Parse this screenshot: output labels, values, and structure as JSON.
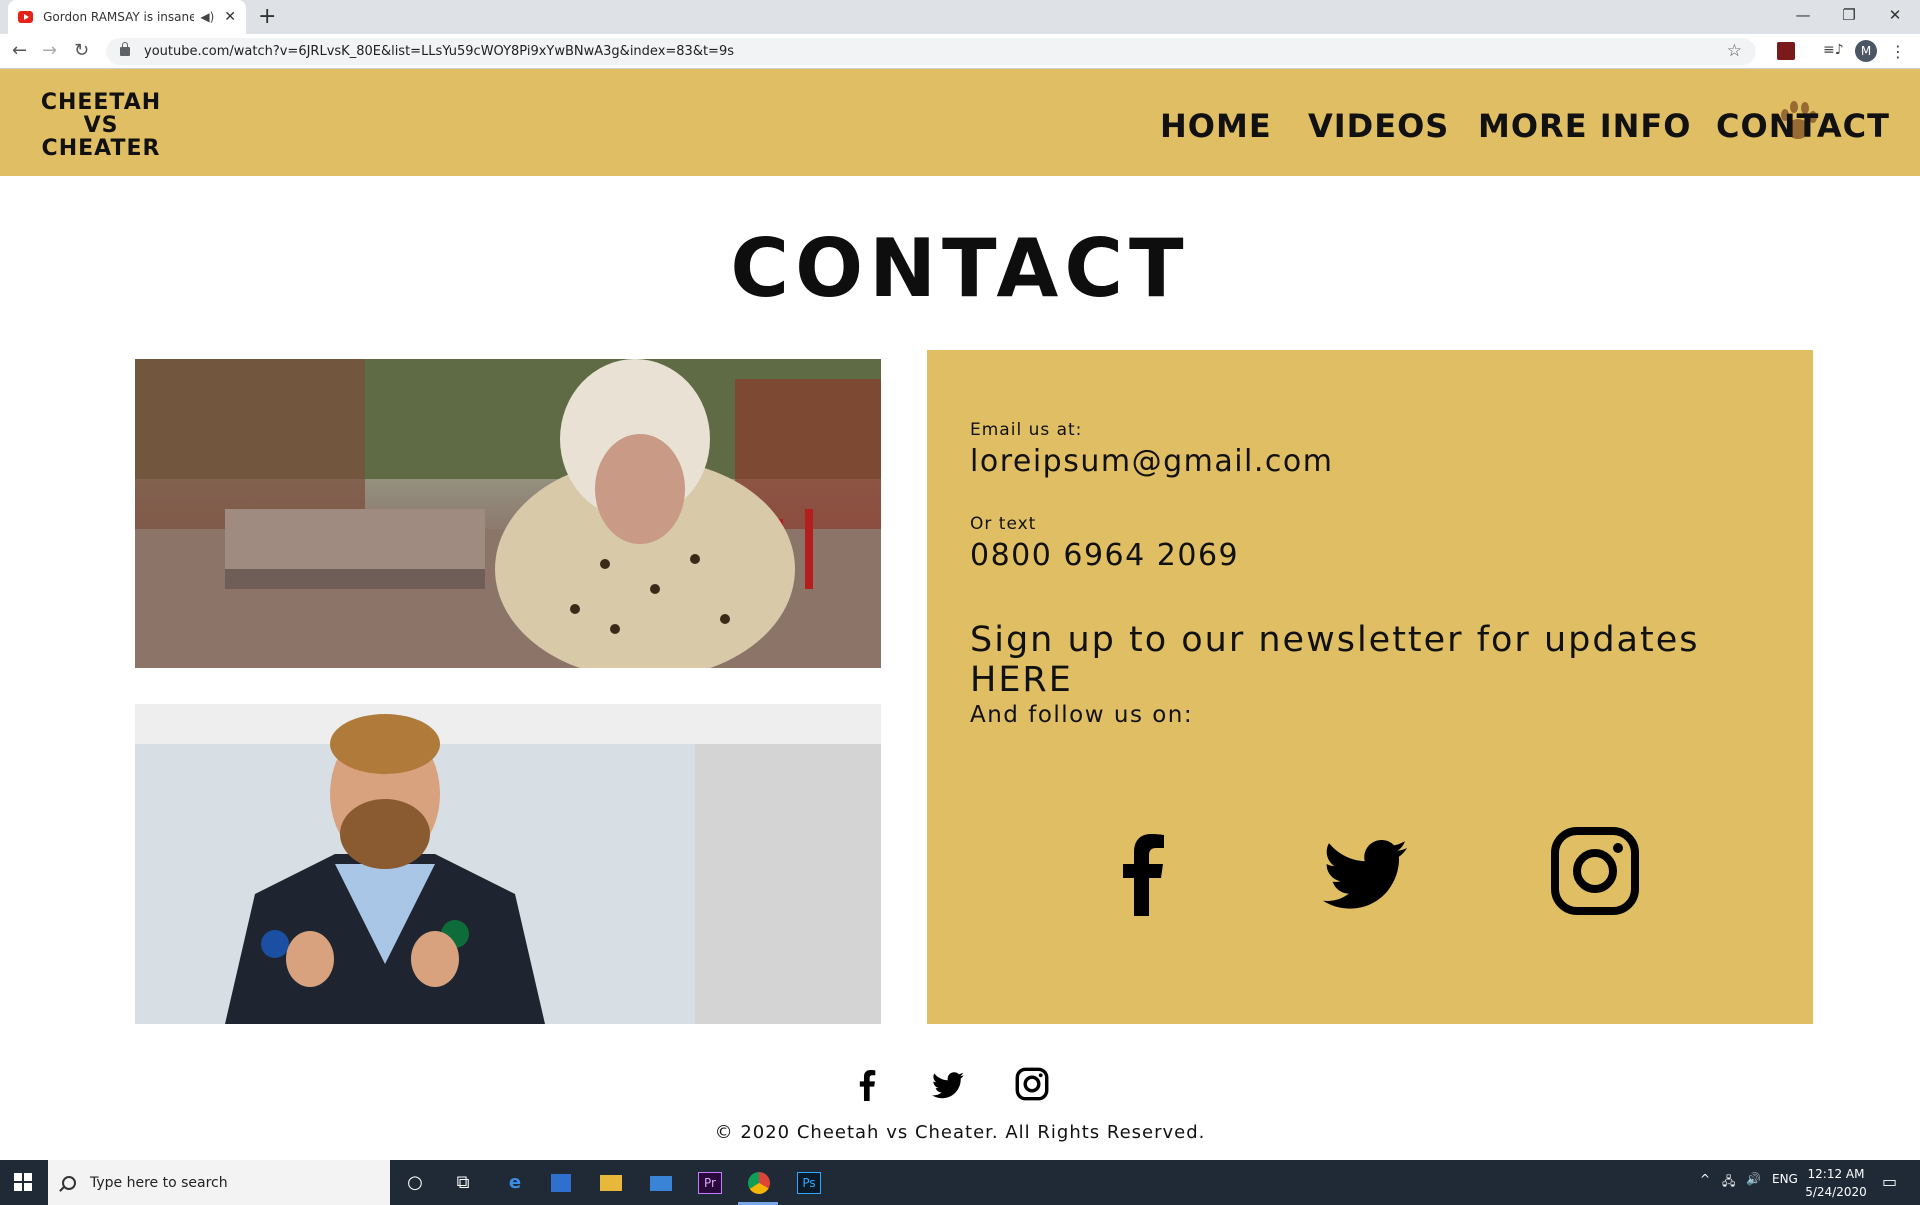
{
  "browser": {
    "tab_title": "Gordon RAMSAY is insane!!!",
    "tab_audio_icon": "speaker-icon",
    "new_tab_label": "+",
    "url": "youtube.com/watch?v=6JRLvsK_80E&list=LLsYu59cWOY8Pi9xYwBNwA3g&index=83&t=9s",
    "profile_initial": "M"
  },
  "site": {
    "logo": "CHEETAH VS CHEATER",
    "logo_lines": [
      "CHEETAH",
      "VS",
      "CHEATER"
    ],
    "nav": [
      "HOME",
      "VIDEOS",
      "MORE INFO",
      "CONTACT"
    ],
    "page_title": "CONTACT",
    "contact": {
      "email_label": "Email us at:",
      "email": "loreipsum@gmail.com",
      "text_label": "Or text",
      "phone": "0800 6964 2069",
      "newsletter": "Sign up to our newsletter for updates HERE",
      "follow": "And follow us on:"
    },
    "social": [
      "facebook-icon",
      "twitter-icon",
      "instagram-icon"
    ],
    "copyright": "© 2020 Cheetah vs Cheater. All Rights Reserved.",
    "colors": {
      "header": "#e0be64",
      "text": "#111111"
    }
  },
  "taskbar": {
    "search_placeholder": "Type here to search",
    "lang": "ENG",
    "time": "12:12 AM",
    "date": "5/24/2020"
  }
}
